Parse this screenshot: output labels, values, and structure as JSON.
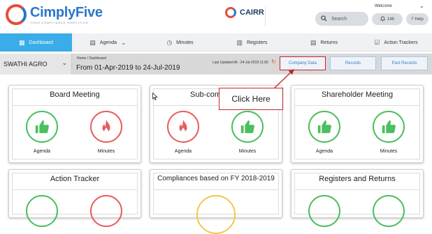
{
  "header": {
    "brand": "CimplyFive",
    "tagline": "YOUR COMPLIANCE SIMPLIFIED",
    "product": "CAIRR",
    "welcome": "Welcome",
    "search_placeholder": "Search",
    "notifications_count": "146",
    "help_label": "Help"
  },
  "nav": {
    "items": [
      {
        "label": "Dashboard",
        "icon": "dashboard-icon"
      },
      {
        "label": "Agenda",
        "icon": "agenda-icon"
      },
      {
        "label": "Minutes",
        "icon": "clock-icon"
      },
      {
        "label": "Registers",
        "icon": "registers-icon"
      },
      {
        "label": "Returns",
        "icon": "returns-icon"
      },
      {
        "label": "Action Trackers",
        "icon": "tracker-icon"
      }
    ]
  },
  "subbar": {
    "company": "SWATHI AGRO",
    "breadcrumb": "Home  /  Dashboard",
    "date_range": "From 01-Apr-2019 to 24-Jul-2019",
    "last_updated": "Last Updated At : 24-Jul-2019 11:00",
    "buttons": [
      "Company Data",
      "Records",
      "Past Records"
    ]
  },
  "cards": [
    {
      "title": "Board Meeting",
      "items": [
        "Agenda",
        "Minutes"
      ]
    },
    {
      "title": "Sub-committee",
      "items": [
        "Agenda",
        "Minutes"
      ]
    },
    {
      "title": "Shareholder Meeting",
      "items": [
        "Agenda",
        "Minutes"
      ]
    },
    {
      "title": "Action Tracker"
    },
    {
      "title": "Compliances based on FY 2018-2019"
    },
    {
      "title": "Registers and Returns"
    }
  ],
  "callout": "Click Here",
  "colors": {
    "accent": "#3aace7",
    "green": "#4bbf5f",
    "red": "#e85d5d",
    "highlight": "#d0202a"
  }
}
